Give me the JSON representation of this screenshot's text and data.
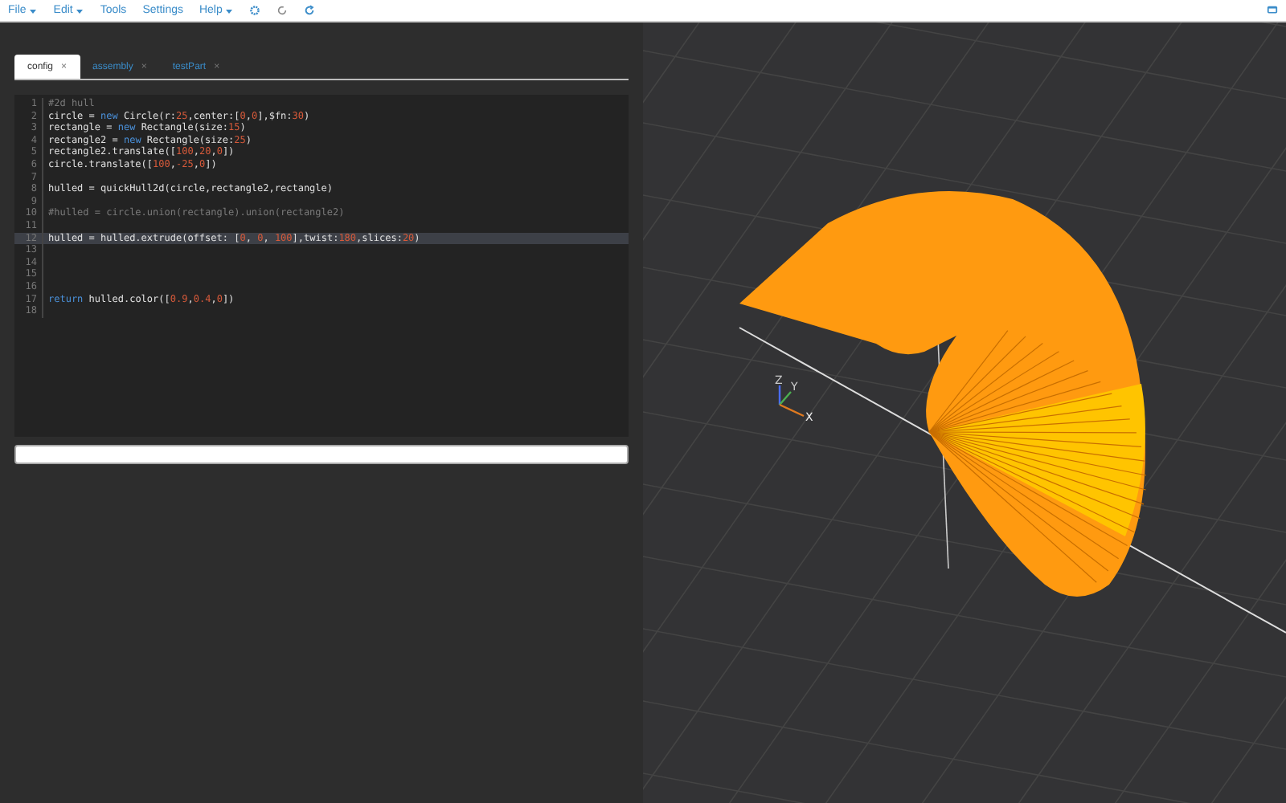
{
  "menu": [
    {
      "label": "File",
      "dropdown": true
    },
    {
      "label": "Edit",
      "dropdown": true
    },
    {
      "label": "Tools",
      "dropdown": false
    },
    {
      "label": "Settings",
      "dropdown": false
    },
    {
      "label": "Help",
      "dropdown": true
    }
  ],
  "tabs": [
    {
      "label": "config",
      "close": "×",
      "selected": true
    },
    {
      "label": "assembly",
      "close": "×",
      "selected": false
    },
    {
      "label": "testPart",
      "close": "×",
      "selected": false
    }
  ],
  "editor": {
    "lines": [
      {
        "number": "1",
        "current": false,
        "tokens": [
          {
            "text": "#2d hull",
            "kind": "comment"
          }
        ]
      },
      {
        "number": "2",
        "current": false,
        "tokens": [
          {
            "text": "circle = ",
            "kind": "plain"
          },
          {
            "text": "new",
            "kind": "keyword"
          },
          {
            "text": " Circle(r:",
            "kind": "plain"
          },
          {
            "text": "25",
            "kind": "number"
          },
          {
            "text": ",center:[",
            "kind": "plain"
          },
          {
            "text": "0",
            "kind": "number"
          },
          {
            "text": ",",
            "kind": "plain"
          },
          {
            "text": "0",
            "kind": "number"
          },
          {
            "text": "],$fn:",
            "kind": "plain"
          },
          {
            "text": "30",
            "kind": "number"
          },
          {
            "text": ")",
            "kind": "plain"
          }
        ]
      },
      {
        "number": "3",
        "current": false,
        "tokens": [
          {
            "text": "rectangle = ",
            "kind": "plain"
          },
          {
            "text": "new",
            "kind": "keyword"
          },
          {
            "text": " Rectangle(size:",
            "kind": "plain"
          },
          {
            "text": "15",
            "kind": "number"
          },
          {
            "text": ")",
            "kind": "plain"
          }
        ]
      },
      {
        "number": "4",
        "current": false,
        "tokens": [
          {
            "text": "rectangle2 = ",
            "kind": "plain"
          },
          {
            "text": "new",
            "kind": "keyword"
          },
          {
            "text": " Rectangle(size:",
            "kind": "plain"
          },
          {
            "text": "25",
            "kind": "number"
          },
          {
            "text": ")",
            "kind": "plain"
          }
        ]
      },
      {
        "number": "5",
        "current": false,
        "tokens": [
          {
            "text": "rectangle2.translate([",
            "kind": "plain"
          },
          {
            "text": "100",
            "kind": "number"
          },
          {
            "text": ",",
            "kind": "plain"
          },
          {
            "text": "20",
            "kind": "number"
          },
          {
            "text": ",",
            "kind": "plain"
          },
          {
            "text": "0",
            "kind": "number"
          },
          {
            "text": "])",
            "kind": "plain"
          }
        ]
      },
      {
        "number": "6",
        "current": false,
        "tokens": [
          {
            "text": "circle.translate([",
            "kind": "plain"
          },
          {
            "text": "100",
            "kind": "number"
          },
          {
            "text": ",",
            "kind": "plain"
          },
          {
            "text": "-25",
            "kind": "number"
          },
          {
            "text": ",",
            "kind": "plain"
          },
          {
            "text": "0",
            "kind": "number"
          },
          {
            "text": "])",
            "kind": "plain"
          }
        ]
      },
      {
        "number": "7",
        "current": false
      },
      {
        "number": "8",
        "current": false,
        "tokens": [
          {
            "text": "hulled = quickHull2d(circle,rectangle2,rectangle)",
            "kind": "plain"
          }
        ]
      },
      {
        "number": "9",
        "current": false
      },
      {
        "number": "10",
        "current": false,
        "tokens": [
          {
            "text": "#hulled = circle.union(rectangle).union(rectangle2)",
            "kind": "comment"
          }
        ]
      },
      {
        "number": "11",
        "current": false
      },
      {
        "number": "12",
        "current": true,
        "tokens": [
          {
            "text": "hulled = hulled.extrude(offset: [",
            "kind": "plain"
          },
          {
            "text": "0",
            "kind": "number"
          },
          {
            "text": ", ",
            "kind": "plain"
          },
          {
            "text": "0",
            "kind": "number"
          },
          {
            "text": ", ",
            "kind": "plain"
          },
          {
            "text": "100",
            "kind": "number"
          },
          {
            "text": "],twist:",
            "kind": "plain"
          },
          {
            "text": "180",
            "kind": "number"
          },
          {
            "text": ",slices:",
            "kind": "plain"
          },
          {
            "text": "20",
            "kind": "number"
          },
          {
            "text": ")",
            "kind": "plain"
          }
        ]
      },
      {
        "number": "13",
        "current": false
      },
      {
        "number": "14",
        "current": false
      },
      {
        "number": "15",
        "current": false
      },
      {
        "number": "16",
        "current": false
      },
      {
        "number": "17",
        "current": false,
        "tokens": [
          {
            "text": "return",
            "kind": "keyword"
          },
          {
            "text": " hulled.color([",
            "kind": "plain"
          },
          {
            "text": "0.9",
            "kind": "number"
          },
          {
            "text": ",",
            "kind": "plain"
          },
          {
            "text": "0.4",
            "kind": "number"
          },
          {
            "text": ",",
            "kind": "plain"
          },
          {
            "text": "0",
            "kind": "number"
          },
          {
            "text": "])",
            "kind": "plain"
          }
        ]
      },
      {
        "number": "18",
        "current": false
      }
    ]
  },
  "axes": {
    "z": "Z",
    "y": "Y",
    "x": "X"
  }
}
